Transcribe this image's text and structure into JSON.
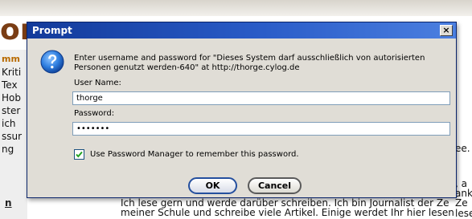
{
  "background_page": {
    "headline_fragment": "or",
    "sidebar_words": [
      "mm",
      "Kriti",
      "Tex",
      "Hob",
      "ster",
      "ich",
      "ssur",
      "ng"
    ],
    "link_fragment": "n",
    "right_edge_fragments": [
      "ee.",
      ", a",
      "ank",
      "Ze",
      "lese"
    ],
    "text_lines": [
      "Ich lese gern und werde darüber schreiben. Ich bin Journalist der Ze",
      "meiner Schule und schreibe viele Artikel. Einige werdet Ihr hier lesen"
    ]
  },
  "dialog": {
    "title": "Prompt",
    "close_label": "×",
    "icon": "info-icon",
    "message": "Enter username and password for \"Dieses System darf ausschließlich von autorisierten Personen genutzt werden-640\" at http://thorge.cylog.de",
    "username_label": "User Name:",
    "username_value": "thorge",
    "password_label": "Password:",
    "password_value": "•••••••",
    "remember_label": "Use Password Manager to remember this password.",
    "remember_checked": true,
    "ok_label": "OK",
    "cancel_label": "Cancel"
  },
  "colors": {
    "titlebar": "#2a5cc8",
    "dialog_bg": "#e0ddd6",
    "headline": "#7a3d14"
  }
}
